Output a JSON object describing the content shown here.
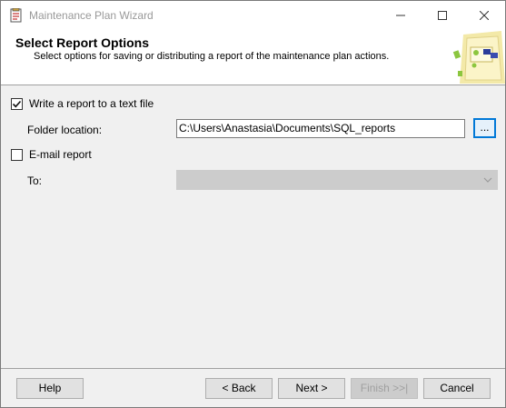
{
  "window": {
    "title": "Maintenance Plan Wizard"
  },
  "header": {
    "title": "Select Report Options",
    "subtitle": "Select options for saving or distributing a report of the maintenance plan actions."
  },
  "options": {
    "write_report": {
      "label": "Write a report to a text file",
      "checked": true
    },
    "folder_label": "Folder location:",
    "folder_value": "C:\\Users\\Anastasia\\Documents\\SQL_reports",
    "browse_label": "...",
    "email_report": {
      "label": "E-mail report",
      "checked": false
    },
    "to_label": "To:",
    "to_value": ""
  },
  "footer": {
    "help": "Help",
    "back": "< Back",
    "next": "Next >",
    "finish": "Finish >>|",
    "cancel": "Cancel"
  },
  "icons": {
    "app": "wizard-app-icon",
    "minimize": "minimize-icon",
    "maximize": "maximize-icon",
    "close": "close-icon",
    "header_graphic": "wizard-header-graphic",
    "dropdown": "chevron-down-icon",
    "check": "checkmark-icon"
  },
  "colors": {
    "accent": "#0078d7",
    "disabled_fill": "#cccccc"
  }
}
